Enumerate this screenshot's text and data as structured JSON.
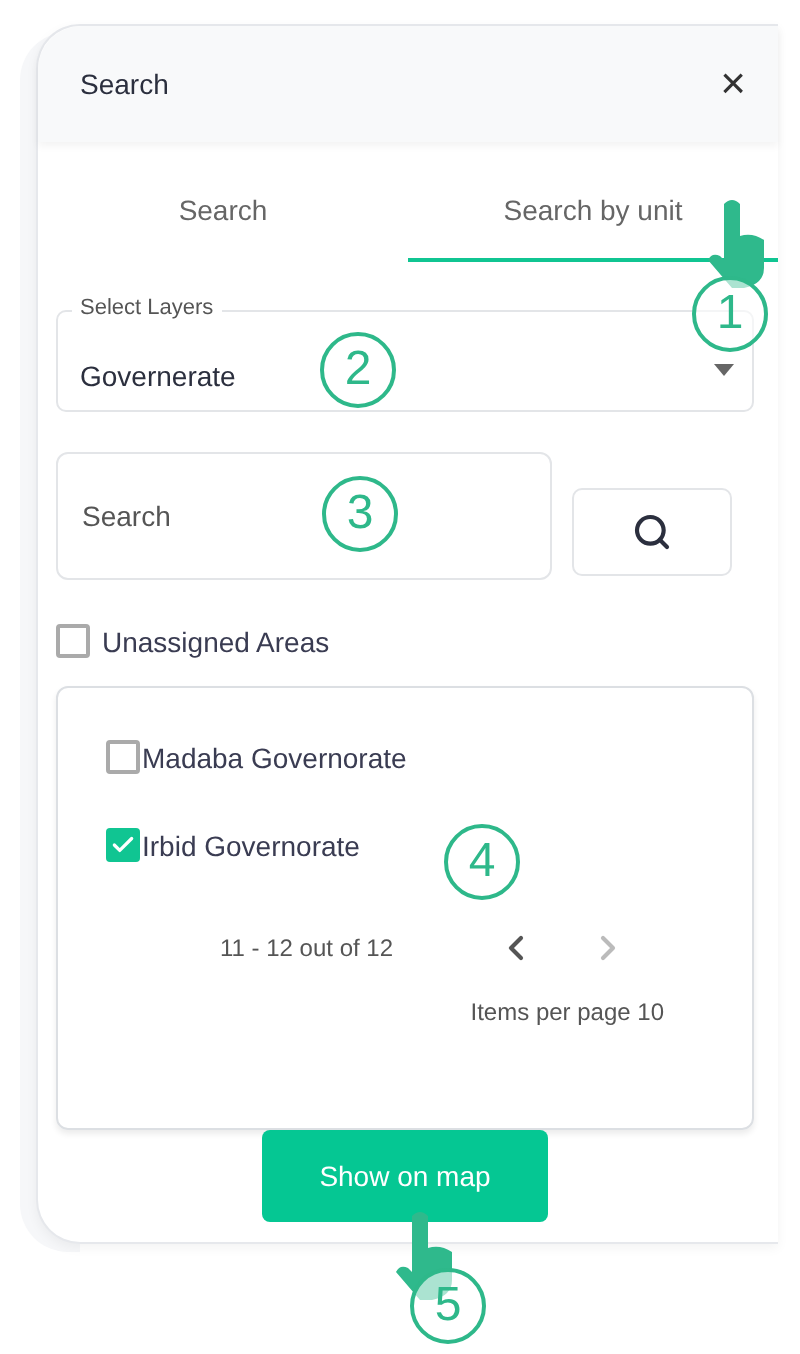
{
  "panel": {
    "title": "Search",
    "close": "×"
  },
  "tabs": [
    {
      "label": "Search",
      "selected": false
    },
    {
      "label": "Search by unit",
      "selected": true
    }
  ],
  "layer_select": {
    "label": "Select Layers",
    "value": "Governerate"
  },
  "search": {
    "placeholder": "Search"
  },
  "unassigned": {
    "label": "Unassigned Areas",
    "checked": false
  },
  "results": [
    {
      "label": "Madaba Governorate",
      "checked": false
    },
    {
      "label": "Irbid Governorate",
      "checked": true
    }
  ],
  "pagination": {
    "range": "11 - 12 out of 12",
    "prev_disabled": false,
    "next_disabled": true,
    "per_page": "Items per page 10"
  },
  "action": "Show on map",
  "steps": [
    "1",
    "2",
    "3",
    "4",
    "5"
  ]
}
